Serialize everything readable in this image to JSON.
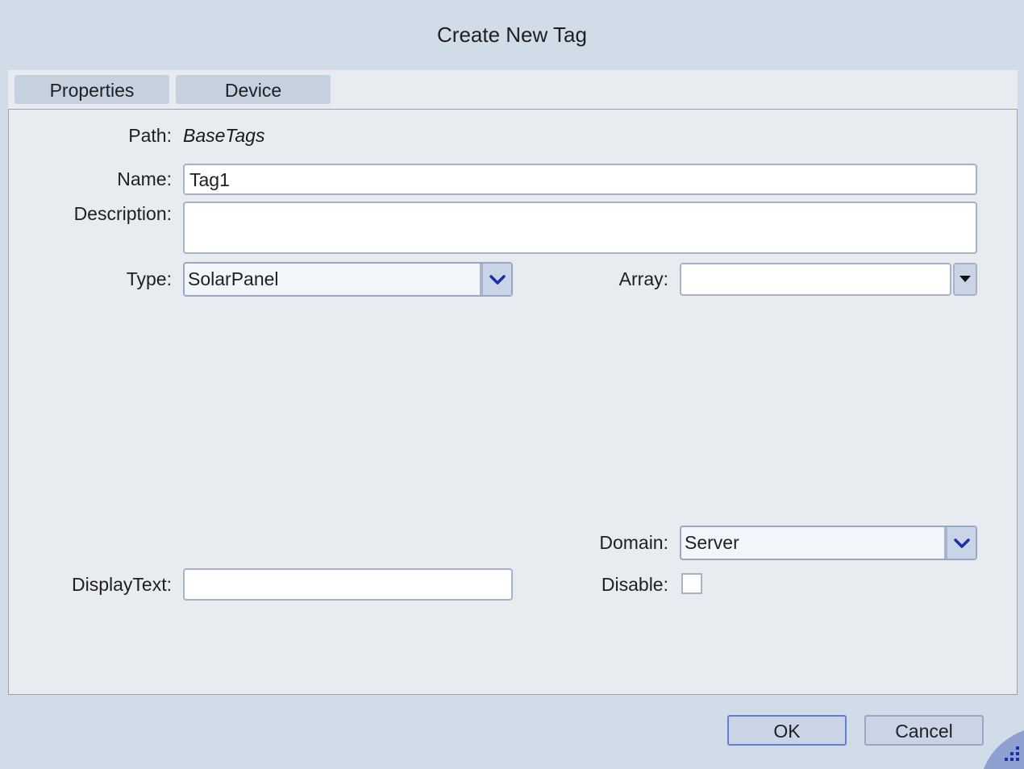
{
  "dialog": {
    "title": "Create New Tag",
    "tabs": [
      {
        "label": "Properties"
      },
      {
        "label": "Device"
      }
    ]
  },
  "form": {
    "path": {
      "label": "Path:",
      "value": "BaseTags"
    },
    "name": {
      "label": "Name:",
      "value": "Tag1"
    },
    "description": {
      "label": "Description:",
      "value": ""
    },
    "type": {
      "label": "Type:",
      "value": "SolarPanel"
    },
    "array": {
      "label": "Array:",
      "value": ""
    },
    "domain": {
      "label": "Domain:",
      "value": "Server"
    },
    "display_text": {
      "label": "DisplayText:",
      "value": ""
    },
    "disable": {
      "label": "Disable:",
      "checked": false
    }
  },
  "footer": {
    "ok_label": "OK",
    "cancel_label": "Cancel"
  },
  "icons": {
    "dropdown": "chevron-down-icon",
    "array_dropdown": "caret-down-icon",
    "resize": "resize-grip-icon"
  },
  "colors": {
    "background": "#d0dce8",
    "panel": "#e8ecf1",
    "accent": "#1a2fa8"
  }
}
